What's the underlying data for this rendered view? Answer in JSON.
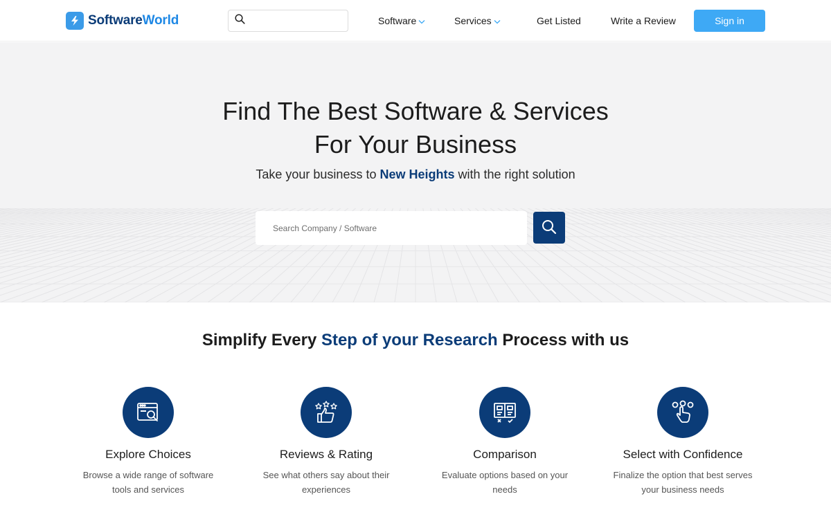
{
  "header": {
    "logo_text_1": "Software",
    "logo_text_2": "World",
    "search_placeholder": "",
    "nav": {
      "software": "Software",
      "services": "Services",
      "get_listed": "Get Listed",
      "write_review": "Write a Review"
    },
    "sign_in": "Sign in"
  },
  "hero": {
    "title_line1": "Find The Best Software & Services",
    "title_line2": "For Your Business",
    "subtitle_pre": "Take your business to ",
    "subtitle_highlight": "New Heights",
    "subtitle_post": " with the right solution",
    "search_placeholder": "Search Company / Software"
  },
  "features": {
    "title_pre": "Simplify Every ",
    "title_highlight": "Step of your Research",
    "title_post": " Process with us",
    "items": [
      {
        "icon": "browser-search-icon",
        "title": "Explore Choices",
        "desc": "Browse a wide range of software tools and services"
      },
      {
        "icon": "thumbs-up-stars-icon",
        "title": "Reviews & Rating",
        "desc": "See what others say about their experiences"
      },
      {
        "icon": "comparison-board-icon",
        "title": "Comparison",
        "desc": "Evaluate options based on your needs"
      },
      {
        "icon": "hand-pointer-select-icon",
        "title": "Select with Confidence",
        "desc": "Finalize the option that best serves your business needs"
      }
    ]
  },
  "colors": {
    "brand_navy": "#0b3c78",
    "brand_blue": "#3ea9f5",
    "hero_bg": "#f3f3f4"
  }
}
